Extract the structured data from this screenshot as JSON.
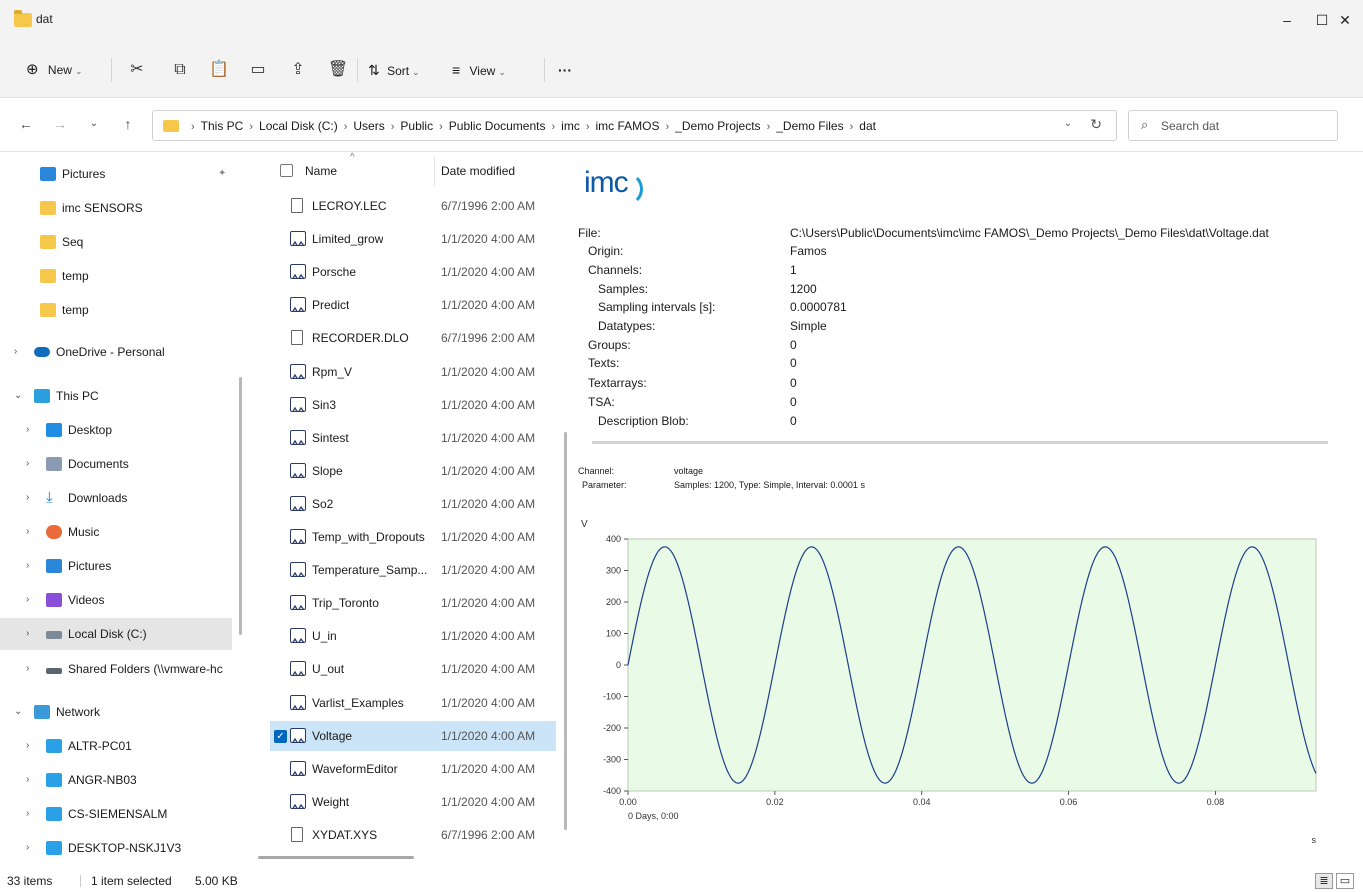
{
  "window": {
    "title": "dat",
    "controls": {
      "minimize": "–",
      "maximize": "☐",
      "close": "✕"
    }
  },
  "toolbar": {
    "new_label": "New",
    "sort_label": "Sort",
    "view_label": "View",
    "more_label": "···"
  },
  "address": {
    "crumbs": [
      "This PC",
      "Local Disk (C:)",
      "Users",
      "Public",
      "Public Documents",
      "imc",
      "imc FAMOS",
      "_Demo Projects",
      "_Demo Files",
      "dat"
    ],
    "search_placeholder": "Search dat"
  },
  "nav": {
    "items": [
      {
        "label": "Pictures",
        "icon": "pictures-icon",
        "pinned": true
      },
      {
        "label": "imc SENSORS",
        "icon": "folder-icon"
      },
      {
        "label": "Seq",
        "icon": "folder-icon"
      },
      {
        "label": "temp",
        "icon": "folder-icon"
      },
      {
        "label": "temp",
        "icon": "folder-icon"
      },
      {
        "label": "OneDrive - Personal",
        "icon": "onedrive-icon"
      },
      {
        "label": "This PC",
        "icon": "pc-icon"
      },
      {
        "label": "Desktop",
        "icon": "desktop-icon"
      },
      {
        "label": "Documents",
        "icon": "documents-icon"
      },
      {
        "label": "Downloads",
        "icon": "downloads-icon"
      },
      {
        "label": "Music",
        "icon": "music-icon"
      },
      {
        "label": "Pictures",
        "icon": "pictures-icon"
      },
      {
        "label": "Videos",
        "icon": "videos-icon"
      },
      {
        "label": "Local Disk (C:)",
        "icon": "disk-icon",
        "selected": true
      },
      {
        "label": "Shared Folders (\\\\vmware-hc",
        "icon": "share-icon"
      },
      {
        "label": "Network",
        "icon": "network-icon"
      },
      {
        "label": "ALTR-PC01",
        "icon": "monitor-icon"
      },
      {
        "label": "ANGR-NB03",
        "icon": "monitor-icon"
      },
      {
        "label": "CS-SIEMENSALM",
        "icon": "monitor-icon"
      },
      {
        "label": "DESKTOP-NSKJ1V3",
        "icon": "monitor-icon"
      }
    ]
  },
  "files": {
    "header": {
      "name": "Name",
      "date": "Date modified"
    },
    "rows": [
      {
        "name": "LECROY.LEC",
        "date": "6/7/1996 2:00 AM",
        "type": "doc"
      },
      {
        "name": "Limited_grow",
        "date": "1/1/2020 4:00 AM",
        "type": "wave"
      },
      {
        "name": "Porsche",
        "date": "1/1/2020 4:00 AM",
        "type": "wave"
      },
      {
        "name": "Predict",
        "date": "1/1/2020 4:00 AM",
        "type": "wave"
      },
      {
        "name": "RECORDER.DLO",
        "date": "6/7/1996 2:00 AM",
        "type": "doc"
      },
      {
        "name": "Rpm_V",
        "date": "1/1/2020 4:00 AM",
        "type": "wave"
      },
      {
        "name": "Sin3",
        "date": "1/1/2020 4:00 AM",
        "type": "wave"
      },
      {
        "name": "Sintest",
        "date": "1/1/2020 4:00 AM",
        "type": "wave"
      },
      {
        "name": "Slope",
        "date": "1/1/2020 4:00 AM",
        "type": "wave"
      },
      {
        "name": "So2",
        "date": "1/1/2020 4:00 AM",
        "type": "wave"
      },
      {
        "name": "Temp_with_Dropouts",
        "date": "1/1/2020 4:00 AM",
        "type": "wave"
      },
      {
        "name": "Temperature_Samp...",
        "date": "1/1/2020 4:00 AM",
        "type": "wave"
      },
      {
        "name": "Trip_Toronto",
        "date": "1/1/2020 4:00 AM",
        "type": "wave"
      },
      {
        "name": "U_in",
        "date": "1/1/2020 4:00 AM",
        "type": "wave"
      },
      {
        "name": "U_out",
        "date": "1/1/2020 4:00 AM",
        "type": "wave"
      },
      {
        "name": "Varlist_Examples",
        "date": "1/1/2020 4:00 AM",
        "type": "wave"
      },
      {
        "name": "Voltage",
        "date": "1/1/2020 4:00 AM",
        "type": "wave",
        "selected": true
      },
      {
        "name": "WaveformEditor",
        "date": "1/1/2020 4:00 AM",
        "type": "wave"
      },
      {
        "name": "Weight",
        "date": "1/1/2020 4:00 AM",
        "type": "wave"
      },
      {
        "name": "XYDAT.XYS",
        "date": "6/7/1996 2:00 AM",
        "type": "doc"
      }
    ]
  },
  "preview": {
    "logo_text": "imc",
    "properties": [
      {
        "key": "File:",
        "value": "C:\\Users\\Public\\Documents\\imc\\imc FAMOS\\_Demo Projects\\_Demo Files\\dat\\Voltage.dat",
        "indent": 0
      },
      {
        "key": "Origin:",
        "value": "Famos",
        "indent": 1
      },
      {
        "key": "Channels:",
        "value": "1",
        "indent": 1
      },
      {
        "key": "Samples:",
        "value": "1200",
        "indent": 2
      },
      {
        "key": "Sampling intervals [s]:",
        "value": "0.0000781",
        "indent": 2
      },
      {
        "key": "Datatypes:",
        "value": "Simple",
        "indent": 2
      },
      {
        "key": "Groups:",
        "value": "0",
        "indent": 1
      },
      {
        "key": "Texts:",
        "value": "0",
        "indent": 1
      },
      {
        "key": "Textarrays:",
        "value": "0",
        "indent": 1
      },
      {
        "key": "TSA:",
        "value": "0",
        "indent": 1
      },
      {
        "key": "Description Blob:",
        "value": "0",
        "indent": 2
      }
    ],
    "channel_label": "Channel:",
    "channel_value": "voltage",
    "parameter_label": "Parameter:",
    "parameter_value": "Samples: 1200, Type: Simple, Interval: 0.0001 s"
  },
  "chart_data": {
    "type": "line",
    "ylabel": "V",
    "xlabel": "s",
    "x_origin_label": "0 Days, 0:00",
    "xlim": [
      0,
      0.0937
    ],
    "ylim": [
      -400,
      400
    ],
    "xticks": [
      "0.00",
      "0.02",
      "0.04",
      "0.06",
      "0.08"
    ],
    "xtick_values": [
      0,
      0.02,
      0.04,
      0.06,
      0.08
    ],
    "yticks": [
      "400",
      "300",
      "200",
      "100",
      "0",
      "-100",
      "-200",
      "-300",
      "-400"
    ],
    "ytick_values": [
      400,
      300,
      200,
      100,
      0,
      -100,
      -200,
      -300,
      -400
    ],
    "series": [
      {
        "function": "sine",
        "amplitude": 375,
        "frequency_hz": 50,
        "x_start": 0,
        "x_end": 0.0937
      }
    ],
    "colors": {
      "plot_bg": "#e9fbe6",
      "line": "#1b3f8c",
      "frame": "#b9c9b6"
    }
  },
  "status": {
    "items_count": "33 items",
    "selection": "1 item selected",
    "size": "5.00 KB"
  }
}
